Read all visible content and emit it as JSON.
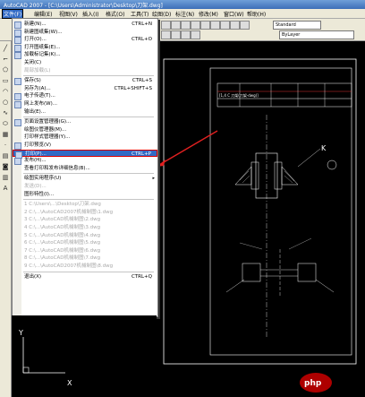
{
  "window": {
    "title": "AutoCAD 2007 - [C:\\Users\\Administrator\\Desktop\\刀架.dwg]"
  },
  "menubar": {
    "items": [
      {
        "label": "文件(F)",
        "active": true
      },
      {
        "label": "编辑(E)"
      },
      {
        "label": "视图(V)"
      },
      {
        "label": "插入(I)"
      },
      {
        "label": "格式(O)"
      },
      {
        "label": "工具(T)"
      },
      {
        "label": "绘图(D)"
      },
      {
        "label": "标注(N)"
      },
      {
        "label": "修改(M)"
      },
      {
        "label": "窗口(W)"
      },
      {
        "label": "帮助(H)"
      }
    ]
  },
  "toolbar": {
    "style_combo": "Standard",
    "layer_combo": "ByLayer"
  },
  "file_menu": {
    "items": [
      {
        "label": "新建(N)...",
        "shortcut": "CTRL+N",
        "icon": "new-icon"
      },
      {
        "label": "新建图纸集(W)...",
        "shortcut": "",
        "icon": "sheetset-icon"
      },
      {
        "label": "打开(O)...",
        "shortcut": "CTRL+O",
        "icon": "open-icon"
      },
      {
        "label": "打开图纸集(E)...",
        "shortcut": "",
        "icon": "open-sheetset-icon"
      },
      {
        "label": "加载标记集(K)...",
        "shortcut": "",
        "icon": "markup-icon"
      },
      {
        "label": "关闭(C)",
        "shortcut": "",
        "icon": ""
      },
      {
        "label": "局部加载(L)",
        "shortcut": "",
        "icon": "",
        "disabled": true
      },
      {
        "sep": true
      },
      {
        "label": "保存(S)",
        "shortcut": "CTRL+S",
        "icon": "save-icon"
      },
      {
        "label": "另存为(A)...",
        "shortcut": "CTRL+SHIFT+S",
        "icon": ""
      },
      {
        "label": "电子传递(T)...",
        "shortcut": "",
        "icon": "etransmit-icon"
      },
      {
        "label": "网上发布(W)...",
        "shortcut": "",
        "icon": "publish-web-icon"
      },
      {
        "label": "输出(E)...",
        "shortcut": "",
        "icon": ""
      },
      {
        "sep": true
      },
      {
        "label": "页面设置管理器(G)...",
        "shortcut": "",
        "icon": "page-setup-icon"
      },
      {
        "label": "绘图仪管理器(M)...",
        "shortcut": "",
        "icon": ""
      },
      {
        "label": "打印样式管理器(Y)...",
        "shortcut": "",
        "icon": ""
      },
      {
        "label": "打印预览(V)",
        "shortcut": "",
        "icon": "preview-icon"
      },
      {
        "label": "打印(P)...",
        "shortcut": "CTRL+P",
        "icon": "print-icon",
        "highlight": true
      },
      {
        "label": "发布(H)...",
        "shortcut": "",
        "icon": "publish-icon"
      },
      {
        "label": "查看打印和发布详细信息(B)...",
        "shortcut": "",
        "icon": ""
      },
      {
        "sep": true
      },
      {
        "label": "绘图实用程序(U)",
        "shortcut": "",
        "icon": "",
        "submenu": true
      },
      {
        "label": "发送(D)...",
        "shortcut": "",
        "icon": "",
        "disabled": true
      },
      {
        "label": "图形特性(I)...",
        "shortcut": "",
        "icon": ""
      },
      {
        "sep": true
      },
      {
        "label": "1 C:\\Users\\...\\Desktop\\刀架.dwg",
        "shortcut": "",
        "icon": "",
        "disabled": true
      },
      {
        "label": "2 C:\\...\\AutoCAD2007机械制图\\1.dwg",
        "shortcut": "",
        "icon": "",
        "disabled": true
      },
      {
        "label": "3 C:\\...\\AutoCAD机械制图\\2.dwg",
        "shortcut": "",
        "icon": "",
        "disabled": true
      },
      {
        "label": "4 C:\\...\\AutoCAD机械制图\\3.dwg",
        "shortcut": "",
        "icon": "",
        "disabled": true
      },
      {
        "label": "5 C:\\...\\AutoCAD机械制图\\4.dwg",
        "shortcut": "",
        "icon": "",
        "disabled": true
      },
      {
        "label": "6 C:\\...\\AutoCAD机械制图\\5.dwg",
        "shortcut": "",
        "icon": "",
        "disabled": true
      },
      {
        "label": "7 C:\\...\\AutoCAD机械制图\\6.dwg",
        "shortcut": "",
        "icon": "",
        "disabled": true
      },
      {
        "label": "8 C:\\...\\AutoCAD机械制图\\7.dwg",
        "shortcut": "",
        "icon": "",
        "disabled": true
      },
      {
        "label": "9 C:\\...\\AutoCAD2007机械制图\\8.dwg",
        "shortcut": "",
        "icon": "",
        "disabled": true
      },
      {
        "sep": true
      },
      {
        "label": "退出(X)",
        "shortcut": "CTRL+Q",
        "icon": ""
      }
    ]
  },
  "drawing": {
    "annotation_arrow_color": "#e02020",
    "label_k": "K",
    "title_block_text": "[1,4 C 刀架(刀架-dwg)]"
  },
  "ucs": {
    "x": "X",
    "y": "Y"
  },
  "watermark": "php"
}
